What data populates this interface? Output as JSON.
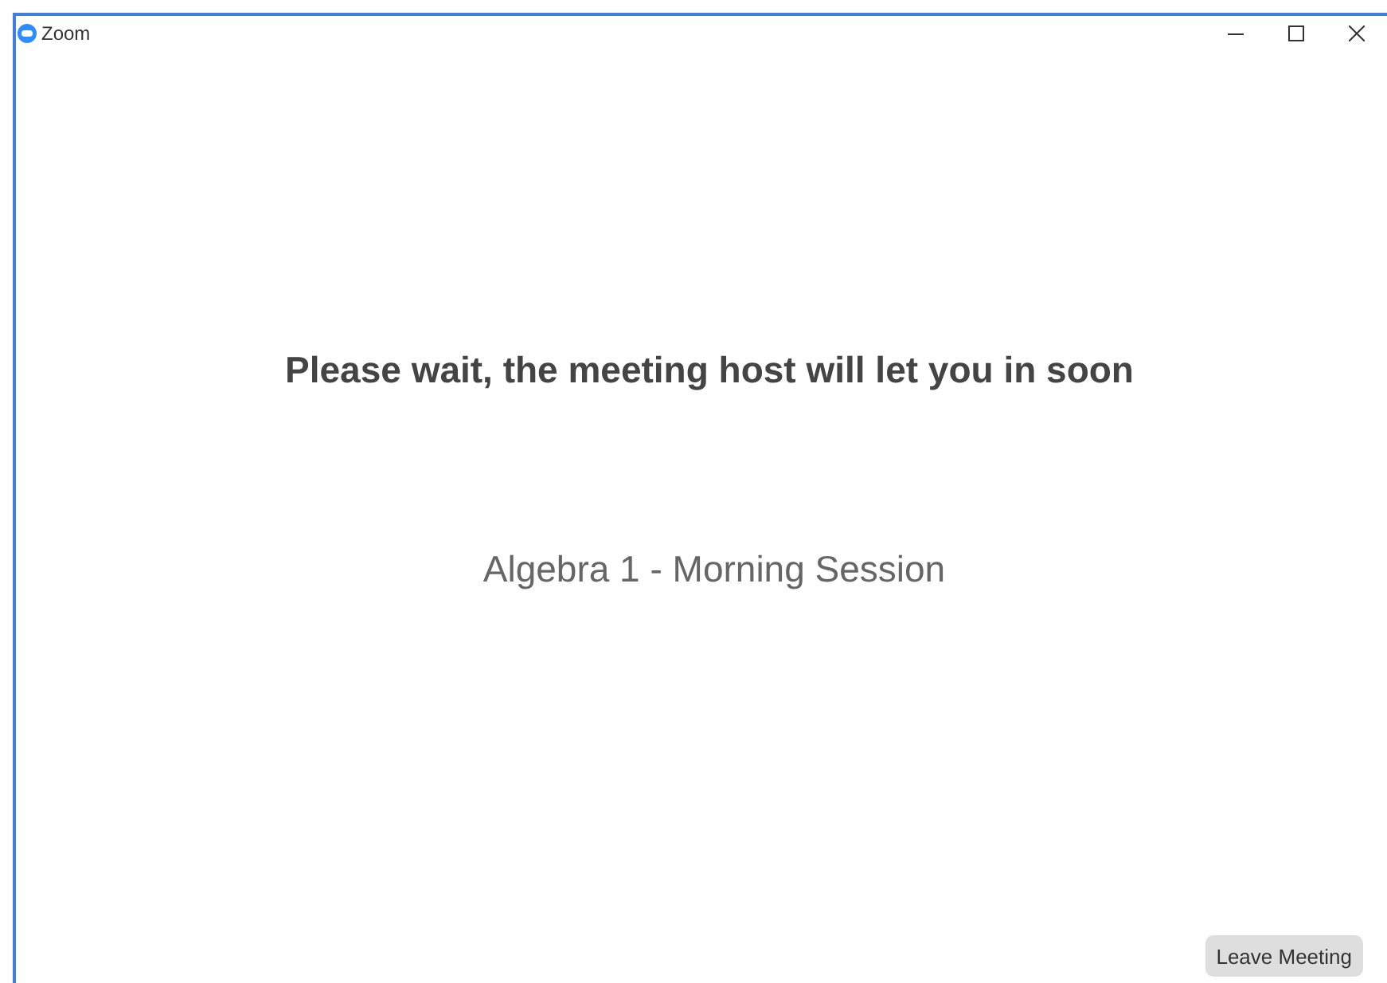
{
  "window": {
    "title": "Zoom"
  },
  "message": "Please wait, the meeting host will let you in soon",
  "meeting_title": "Algebra 1 - Morning Session",
  "buttons": [
    "Leave Meeting"
  ]
}
